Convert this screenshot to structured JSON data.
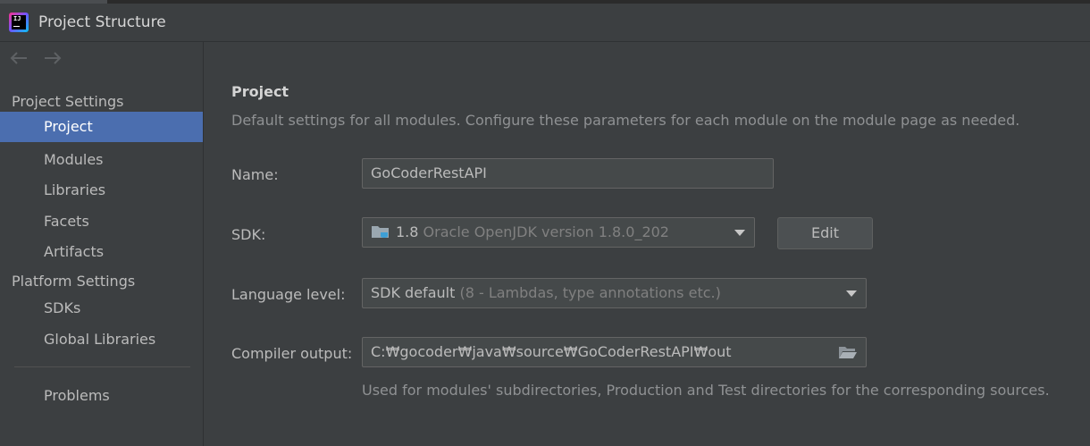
{
  "window": {
    "title": "Project Structure"
  },
  "sidebar": {
    "groups": [
      {
        "label": "Project Settings"
      },
      {
        "label": "Platform Settings"
      }
    ],
    "items": [
      {
        "label": "Project",
        "selected": true
      },
      {
        "label": "Modules"
      },
      {
        "label": "Libraries"
      },
      {
        "label": "Facets"
      },
      {
        "label": "Artifacts"
      },
      {
        "label": "SDKs"
      },
      {
        "label": "Global Libraries"
      },
      {
        "label": "Problems"
      }
    ]
  },
  "main": {
    "title": "Project",
    "description": "Default settings for all modules. Configure these parameters for each module on the module page as needed.",
    "name": {
      "label": "Name:",
      "value": "GoCoderRestAPI"
    },
    "sdk": {
      "label": "SDK:",
      "version": "1.8",
      "detail": "Oracle OpenJDK version 1.8.0_202",
      "edit_label": "Edit"
    },
    "language_level": {
      "label": "Language level:",
      "value": "SDK default",
      "detail": "(8 - Lambdas, type annotations etc.)"
    },
    "compiler_output": {
      "label": "Compiler output:",
      "value": "C:₩gocoder₩java₩source₩GoCoderRestAPI₩out",
      "hint": "Used for modules' subdirectories, Production and Test directories for the corresponding sources."
    }
  },
  "colors": {
    "selection": "#4b6eaf",
    "background": "#3c3f41",
    "field_bg": "#45494a"
  },
  "icons": [
    "intellij-idea-icon",
    "back-arrow-icon",
    "forward-arrow-icon",
    "folder-icon",
    "chevron-down-icon",
    "browse-folder-icon"
  ]
}
